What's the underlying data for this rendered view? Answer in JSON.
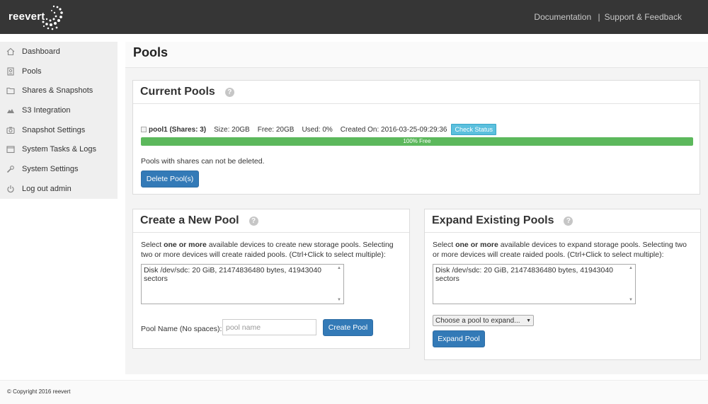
{
  "brand": {
    "name": "reevert"
  },
  "header": {
    "links": [
      {
        "label": "Documentation"
      },
      {
        "label": "Support & Feedback"
      }
    ],
    "separator": "|"
  },
  "sidebar": {
    "items": [
      {
        "label": "Dashboard",
        "icon": "home-icon"
      },
      {
        "label": "Pools",
        "icon": "database-icon"
      },
      {
        "label": "Shares & Snapshots",
        "icon": "folder-icon"
      },
      {
        "label": "S3 Integration",
        "icon": "cloud-icon"
      },
      {
        "label": "Snapshot Settings",
        "icon": "camera-icon"
      },
      {
        "label": "System Tasks & Logs",
        "icon": "window-icon"
      },
      {
        "label": "System Settings",
        "icon": "wrench-icon"
      },
      {
        "label": "Log out admin",
        "icon": "power-icon"
      }
    ]
  },
  "page": {
    "title": "Pools"
  },
  "current_pools": {
    "title": "Current Pools",
    "help": "?",
    "pool": {
      "name": "pool1 (Shares: 3)",
      "size": "Size: 20GB",
      "free": "Free: 20GB",
      "used": "Used: 0%",
      "created": "Created On: 2016-03-25-09:29:36",
      "check_label": "Check Status",
      "progress_label": "100% Free",
      "free_fraction": 1.0
    },
    "note": "Pools with shares can not be deleted.",
    "delete_label": "Delete Pool(s)"
  },
  "create_pool": {
    "title": "Create a New Pool",
    "help": "?",
    "desc_pre": "Select ",
    "desc_bold": "one or more",
    "desc_post": " available devices to create new storage pools. Selecting two or more devices will create raided pools. (Ctrl+Click to select multiple):",
    "devices": [
      "Disk /dev/sdc: 20 GiB, 21474836480 bytes, 41943040 sectors"
    ],
    "name_label": "Pool Name (No spaces):",
    "name_placeholder": "pool name",
    "create_label": "Create Pool"
  },
  "expand_pool": {
    "title": "Expand Existing Pools",
    "help": "?",
    "desc_pre": "Select ",
    "desc_bold": "one or more",
    "desc_post": " available devices to expand storage pools. Selecting two or more devices will create raided pools. (Ctrl+Click to select multiple):",
    "devices": [
      "Disk /dev/sdc: 20 GiB, 21474836480 bytes, 41943040 sectors"
    ],
    "select_value": "Choose a pool to expand...",
    "expand_label": "Expand Pool"
  },
  "footer": {
    "copyright": "© Copyright 2016 reevert"
  }
}
